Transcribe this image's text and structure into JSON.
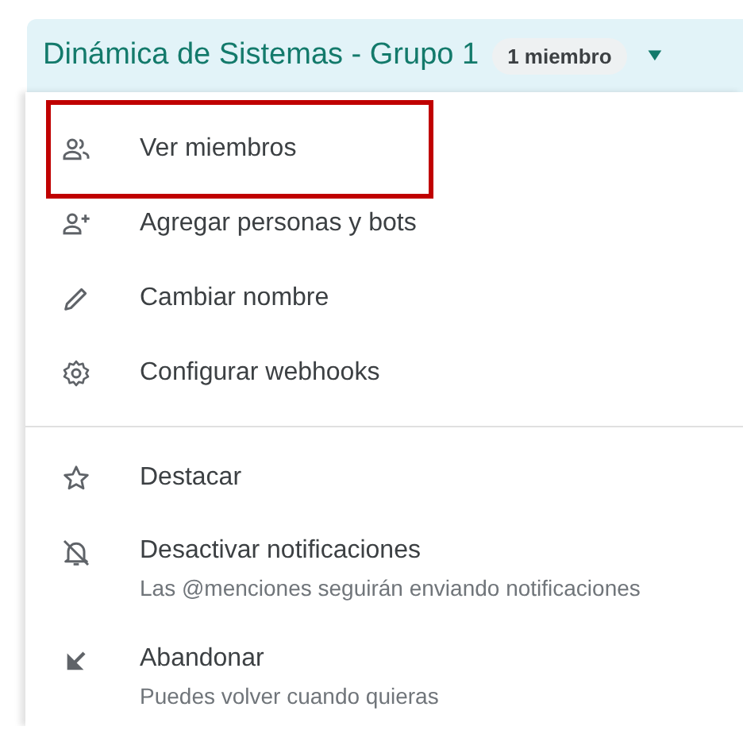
{
  "header": {
    "title": "Dinámica de Sistemas - Grupo 1",
    "member_badge": "1 miembro",
    "caret": "▼"
  },
  "menu": {
    "sections": [
      {
        "items": [
          {
            "label": "Ver miembros",
            "highlighted": true
          },
          {
            "label": "Agregar personas y bots",
            "highlighted": false
          },
          {
            "label": "Cambiar nombre",
            "highlighted": false
          },
          {
            "label": "Configurar webhooks",
            "highlighted": false
          }
        ]
      },
      {
        "items": [
          {
            "label": "Destacar",
            "highlighted": false
          },
          {
            "label": "Desactivar notificaciones",
            "subtitle": "Las @menciones seguirán enviando notificaciones",
            "highlighted": false
          },
          {
            "label": "Abandonar",
            "subtitle": "Puedes volver cuando quieras",
            "highlighted": false
          }
        ]
      }
    ]
  }
}
